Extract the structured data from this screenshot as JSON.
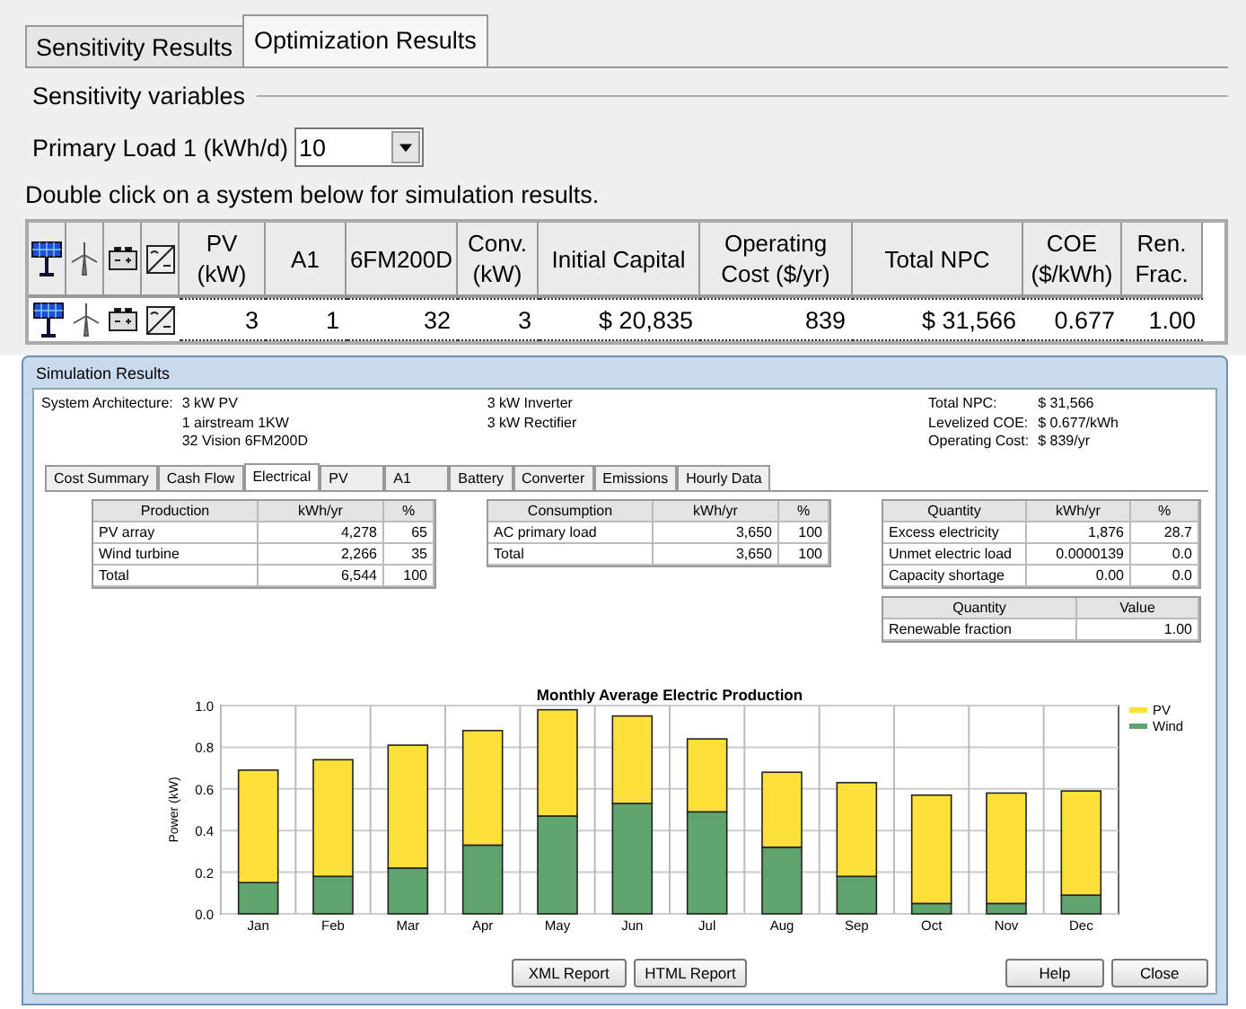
{
  "tabs": [
    {
      "label": "Sensitivity Results",
      "selected": false
    },
    {
      "label": "Optimization Results",
      "selected": true
    }
  ],
  "sensitivity": {
    "title": "Sensitivity variables",
    "variable_label": "Primary Load 1 (kWh/d)",
    "variable_value": "10"
  },
  "instruction": "Double click on a system below for simulation results.",
  "results_table": {
    "columns": [
      "PV (kW)",
      "A1",
      "6FM200D",
      "Conv. (kW)",
      "Initial Capital",
      "Operating Cost ($/yr)",
      "Total NPC",
      "COE ($/kWh)",
      "Ren. Frac."
    ],
    "rows": [
      {
        "cells": [
          "3",
          "1",
          "32",
          "3",
          "$ 20,835",
          "839",
          "$ 31,566",
          "0.677",
          "1.00"
        ],
        "selected": true
      }
    ]
  },
  "simulation": {
    "title": "Simulation Results",
    "architecture_label": "System Architecture:",
    "architecture_col1": [
      "3 kW PV",
      "1 airstream 1KW",
      "32 Vision 6FM200D"
    ],
    "architecture_col2": [
      "3 kW Inverter",
      "3 kW Rectifier"
    ],
    "summary": [
      {
        "label": "Total NPC:",
        "value": "$ 31,566"
      },
      {
        "label": "Levelized COE:",
        "value": "$ 0.677/kWh"
      },
      {
        "label": "Operating Cost:",
        "value": "$ 839/yr"
      }
    ],
    "tabs": [
      {
        "label": "Cost Summary",
        "selected": false
      },
      {
        "label": "Cash Flow",
        "selected": false
      },
      {
        "label": "Electrical",
        "selected": true
      },
      {
        "label": "PV",
        "selected": false
      },
      {
        "label": "A1",
        "selected": false
      },
      {
        "label": "Battery",
        "selected": false
      },
      {
        "label": "Converter",
        "selected": false
      },
      {
        "label": "Emissions",
        "selected": false
      },
      {
        "label": "Hourly Data",
        "selected": false
      }
    ],
    "production_table": {
      "columns": [
        "Production",
        "kWh/yr",
        "%"
      ],
      "rows": [
        [
          "PV array",
          "4,278",
          "65"
        ],
        [
          "Wind turbine",
          "2,266",
          "35"
        ],
        [
          "Total",
          "6,544",
          "100"
        ]
      ]
    },
    "consumption_table": {
      "columns": [
        "Consumption",
        "kWh/yr",
        "%"
      ],
      "rows": [
        [
          "AC primary load",
          "3,650",
          "100"
        ],
        [
          "Total",
          "3,650",
          "100"
        ]
      ]
    },
    "quantity_table": {
      "columns": [
        "Quantity",
        "kWh/yr",
        "%"
      ],
      "rows": [
        [
          "Excess electricity",
          "1,876",
          "28.7"
        ],
        [
          "Unmet electric load",
          "0.0000139",
          "0.0"
        ],
        [
          "Capacity shortage",
          "0.00",
          "0.0"
        ]
      ]
    },
    "value_table": {
      "columns": [
        "Quantity",
        "Value"
      ],
      "rows": [
        [
          "Renewable fraction",
          "1.00"
        ]
      ]
    },
    "chart_data": {
      "type": "bar",
      "title": "Monthly Average Electric Production",
      "ylabel": "Power (kW)",
      "stacked": true,
      "grid": true,
      "legend": true,
      "categories": [
        "Jan",
        "Feb",
        "Mar",
        "Apr",
        "May",
        "Jun",
        "Jul",
        "Aug",
        "Sep",
        "Oct",
        "Nov",
        "Dec"
      ],
      "ylim": [
        0,
        1
      ],
      "yticks": [
        {
          "value": 0,
          "label": "0.0"
        },
        {
          "value": 0.2,
          "label": "0.2"
        },
        {
          "value": 0.4,
          "label": "0.4"
        },
        {
          "value": 0.6,
          "label": "0.6"
        },
        {
          "value": 0.8,
          "label": "0.8"
        },
        {
          "value": 1,
          "label": "1.0"
        }
      ],
      "series": [
        {
          "name": "Wind",
          "color": "#5fa36f",
          "values": [
            0.15,
            0.18,
            0.22,
            0.33,
            0.47,
            0.53,
            0.49,
            0.32,
            0.18,
            0.05,
            0.05,
            0.09
          ]
        },
        {
          "name": "PV",
          "color": "#fde03a",
          "values": [
            0.54,
            0.56,
            0.59,
            0.55,
            0.51,
            0.42,
            0.35,
            0.36,
            0.45,
            0.52,
            0.53,
            0.5
          ]
        }
      ]
    },
    "buttons": [
      {
        "label": "XML Report",
        "kind": "report"
      },
      {
        "label": "HTML Report",
        "kind": "report"
      },
      {
        "label": "Help",
        "kind": "dialog"
      },
      {
        "label": "Close",
        "kind": "dialog"
      }
    ]
  }
}
